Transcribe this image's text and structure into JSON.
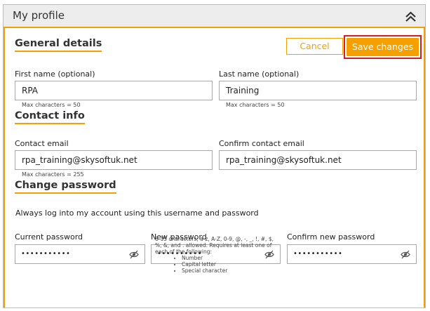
{
  "panel": {
    "title": "My profile"
  },
  "actions": {
    "cancel_label": "Cancel",
    "save_label": "Save changes"
  },
  "general": {
    "title": "General details",
    "first_name": {
      "label": "First name (optional)",
      "value": "RPA",
      "hint": "Max characters = 50"
    },
    "last_name": {
      "label": "Last name (optional)",
      "value": "Training",
      "hint": "Max characters = 50"
    }
  },
  "contact": {
    "title": "Contact info",
    "email": {
      "label": "Contact email",
      "value": "rpa_training@skysoftuk.net",
      "hint": "Max characters = 255"
    },
    "confirm_email": {
      "label": "Confirm contact email",
      "value": "rpa_training@skysoftuk.net"
    }
  },
  "password": {
    "title": "Change password",
    "info": "Always log into my account using this username and password",
    "current": {
      "label": "Current password",
      "value": "•••••••••••"
    },
    "new": {
      "label": "New password",
      "value": "••••••••••"
    },
    "confirm": {
      "label": "Confirm new password",
      "value": "•••••••••••"
    },
    "requirements": "8-15 characters; a-z, A-Z, 0-9, @, -, _, !, #, $, %, &, and . allowed. Requires at least one of each of the following:",
    "requirement_items": [
      "Number",
      "Capital letter",
      "Special character"
    ]
  },
  "icons": {
    "collapse": "chevron-double-up-icon",
    "eye": "eye-slash-icon"
  },
  "colors": {
    "accent": "#f5a000",
    "highlight": "#d11f1f",
    "header_bg": "#ededed"
  }
}
